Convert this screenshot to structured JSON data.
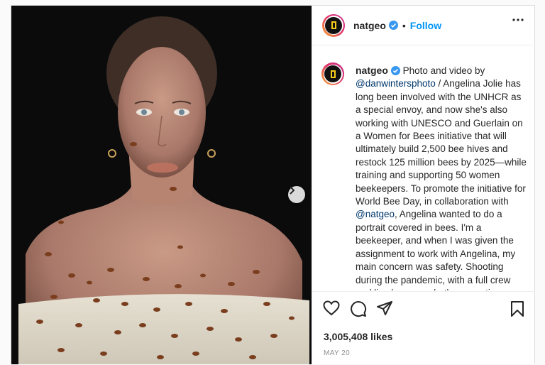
{
  "post": {
    "username": "natgeo",
    "follow_label": "Follow",
    "separator": "•",
    "caption": {
      "username": "natgeo",
      "seg1": " Photo and video by ",
      "handle1": "@danwintersphoto",
      "seg2": " / Angelina Jolie has long been involved with the UNHCR as a special envoy, and now she's also working with UNESCO and Guerlain on a Women for Bees initiative that will ultimately build 2,500 bee hives and restock 125 million bees by 2025—while training and supporting 50 women beekeepers. To promote the initiative for World Bee Day, in collaboration with ",
      "handle2": "@natgeo",
      "seg3": ", Angelina wanted to do a portrait covered in bees. I'm a beekeeper, and when I was given the assignment to work with Angelina, my main concern was safety. Shooting during the pandemic, with a full crew and live bees, made the execution complex. And I knew the"
    },
    "likes": "3,005,408 likes",
    "date": "MAY 20"
  },
  "icons": {
    "verified": "verified-badge-icon",
    "more": "more-horizontal-icon",
    "like": "heart-icon",
    "comment": "comment-icon",
    "share": "paper-plane-icon",
    "save": "bookmark-icon",
    "next": "chevron-right-icon"
  },
  "colors": {
    "accent": "#0095f6",
    "handle": "#00376b",
    "brand_yellow": "#f8cc1b",
    "verified": "#3897f0"
  }
}
